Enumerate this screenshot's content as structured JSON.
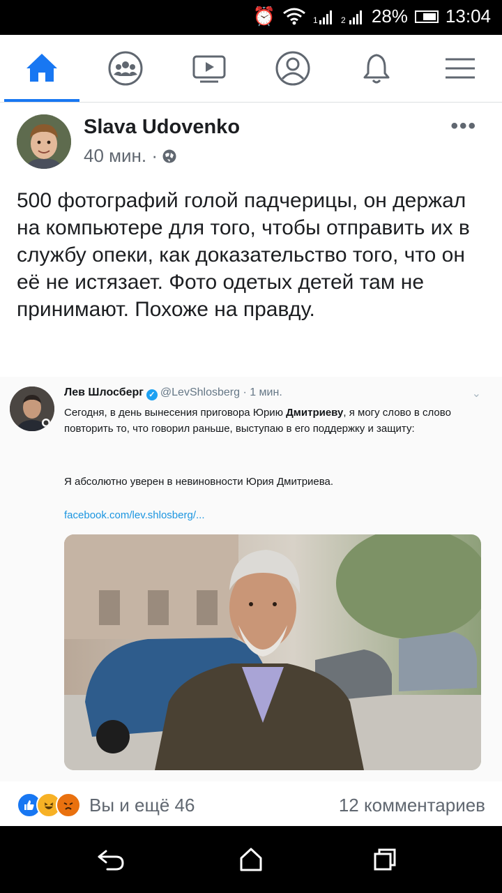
{
  "status_bar": {
    "battery": "28%",
    "time": "13:04",
    "icons": [
      "alarm-icon",
      "wifi-icon",
      "signal-1-icon",
      "signal-2-icon",
      "battery-icon"
    ]
  },
  "nav": {
    "items": [
      {
        "name": "home-icon",
        "active": true
      },
      {
        "name": "groups-icon",
        "active": false
      },
      {
        "name": "watch-icon",
        "active": false
      },
      {
        "name": "profile-icon",
        "active": false
      },
      {
        "name": "bell-icon",
        "active": false
      },
      {
        "name": "menu-icon",
        "active": false
      }
    ],
    "accent": "#1877f2"
  },
  "post": {
    "author": "Slava Udovenko",
    "time": "40 мин. ·",
    "privacy_icon": "globe-icon",
    "more": "•••",
    "text": "500 фотографий голой падчерицы, он держал на компьютере для того, чтобы отправить их в службу опеки, как доказательство того, что он её не истязает. Фото одетых детей там не принимают. Похоже на правду."
  },
  "shared_tweet": {
    "name": "Лев Шлосберг",
    "handle": "@LevShlosberg · 1 мин.",
    "verified": "✓",
    "text_before": "Сегодня, в день вынесения приговора Юрию ",
    "text_bold": "Дмитриеву",
    "text_after": ", я могу слово в слово повторить то, что говорил раньше, выступаю в его поддержку и защиту:",
    "text2": "Я абсолютно уверен в невиновности Юрия Дмитриева.",
    "link": "facebook.com/lev.shlosberg/...",
    "link_color": "#1b95e0"
  },
  "footer": {
    "reactions": [
      "like-icon",
      "haha-icon",
      "angry-icon"
    ],
    "reaction_count": "Вы и ещё 46",
    "comments": "12 комментариев"
  },
  "system_nav": {
    "buttons": [
      "back-icon",
      "home-nav-icon",
      "recents-icon"
    ]
  }
}
